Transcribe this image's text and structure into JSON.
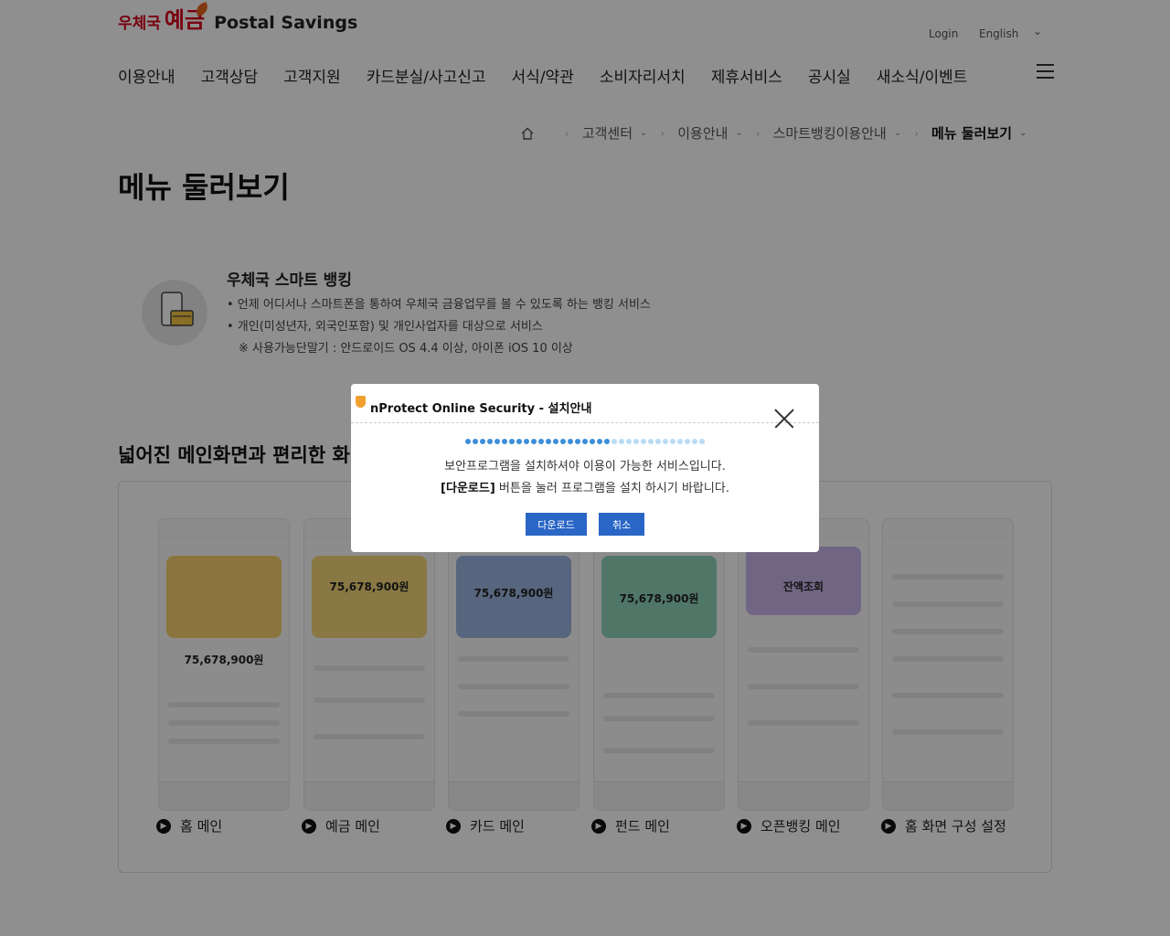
{
  "header": {
    "logo_ko_small": "우체국",
    "logo_ko_big": "예금",
    "logo_en": "Postal Savings",
    "login": "Login",
    "language": "English",
    "chevron": "⌄"
  },
  "gnb": [
    "이용안내",
    "고객상담",
    "고객지원",
    "카드분실/사고신고",
    "서식/약관",
    "소비자리서치",
    "제휴서비스",
    "공시실",
    "새소식/이벤트"
  ],
  "breadcrumb": {
    "separator": "›",
    "items": [
      "고객센터",
      "이용안내",
      "스마트뱅킹이용안내",
      "메뉴 둘러보기"
    ],
    "chevron": "⌄"
  },
  "page_title": "메뉴 둘러보기",
  "intro": {
    "title": "우체국 스마트 뱅킹",
    "bullets": [
      "• 언제 어디서나 스마트폰을 통하여 우체국 금융업무를 볼 수 있도록 하는 뱅킹 서비스",
      "• 개인(미성년자, 외국인포함) 및 개인사업자를 대상으로 서비스"
    ],
    "note": "※ 사용가능단말기 : 안드로이드 OS 4.4 이상, 아이폰 iOS 10 이상"
  },
  "section_title": "넓어진 메인화면과 편리한 화",
  "screens": [
    {
      "label": "홈 메인",
      "amount": "75,678,900원",
      "color": "#f7d36b"
    },
    {
      "label": "예금 메인",
      "amount": "75,678,900원",
      "color": "#f4d77a"
    },
    {
      "label": "카드 메인",
      "amount": "75,678,900원",
      "color": "#9cb4e0"
    },
    {
      "label": "펀드 메인",
      "amount": "75,678,900원",
      "color": "#8fd2b9"
    },
    {
      "label": "오픈뱅킹 메인",
      "amount": "잔액조회",
      "color": "#c8b7ec"
    },
    {
      "label": "홈 화면 구성 설정",
      "amount": "",
      "color": "#f2f2f2"
    }
  ],
  "modal": {
    "title": "nProtect Online Security - 설치안내",
    "message1": "보안프로그램을 설치하셔야 이용이 가능한 서비스입니다.",
    "message2_bold": "[다운로드]",
    "message2_rest": " 버튼을 눌러 프로그램을 설치 하시기 바랍니다.",
    "download": "다운로드",
    "cancel": "취소",
    "progress_dots": 33,
    "progress_active": 20
  },
  "colors": {
    "brand_red": "#d6001c",
    "button_blue": "#2a66c6",
    "progress_blue": "#3c8fd8"
  }
}
